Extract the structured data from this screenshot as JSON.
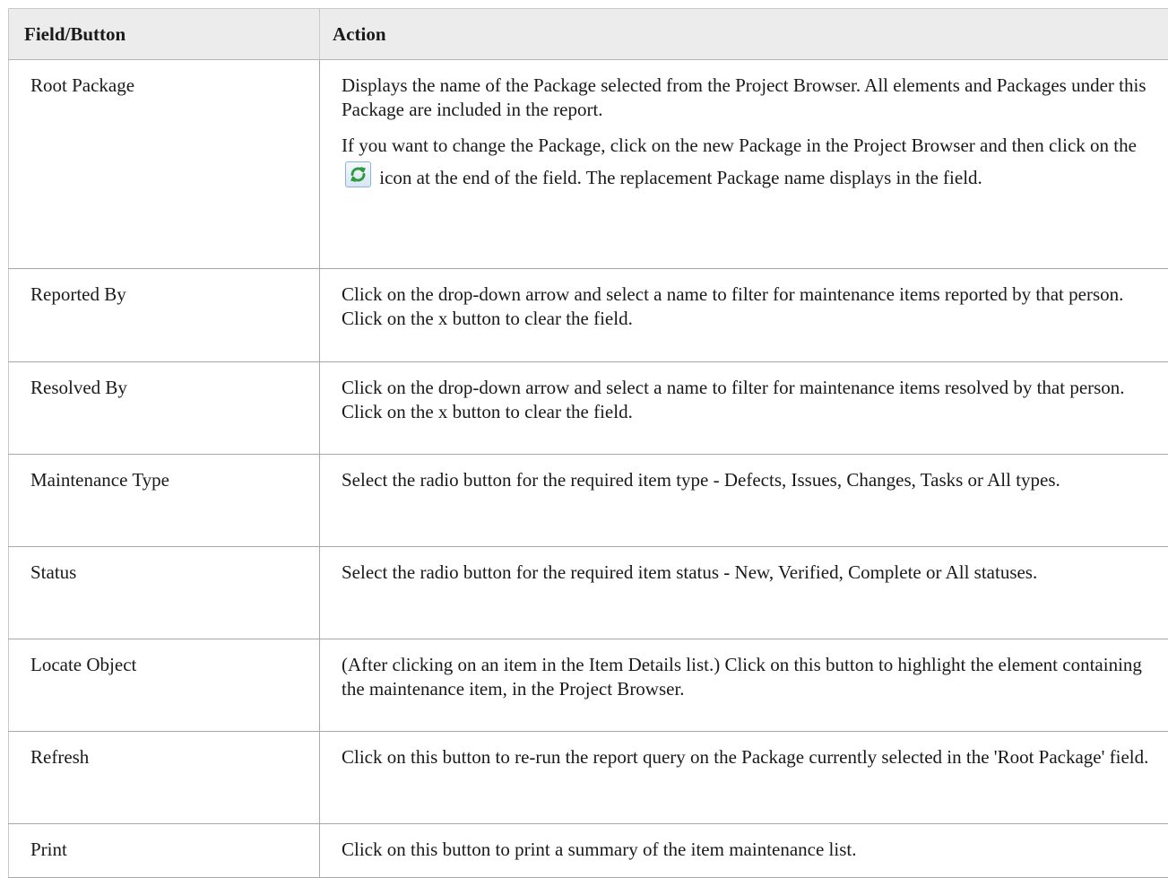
{
  "table": {
    "headers": {
      "field": "Field/Button",
      "action": "Action"
    },
    "rows": [
      {
        "field": "Root Package",
        "action_p1": "Displays the name of the Package selected from the Project Browser. All elements and Packages under this Package are included in the report.",
        "action_p2_before": "If you want to change the Package, click on the new Package in the Project Browser and then click on the",
        "action_p2_icon": "refresh-icon",
        "action_p2_after": "icon at the end of the field. The replacement Package name displays in the field."
      },
      {
        "field": "Reported By",
        "action": "Click on the drop-down arrow and select a name to filter for maintenance items reported by that person. Click on the x button to clear the field."
      },
      {
        "field": "Resolved By",
        "action": "Click on the drop-down arrow and select a name to filter for maintenance items resolved by that person. Click on the x button to clear the field."
      },
      {
        "field": "Maintenance Type",
        "action": "Select the radio button for the required item type - Defects, Issues, Changes, Tasks or All types."
      },
      {
        "field": "Status",
        "action": "Select the radio button for the required item status - New, Verified, Complete or All statuses."
      },
      {
        "field": "Locate Object",
        "action": "(After clicking on an item in the Item Details list.) Click on this button to highlight the element containing the maintenance item, in the Project Browser."
      },
      {
        "field": "Refresh",
        "action": "Click on this button to re-run the report query on the Package currently selected in the 'Root Package' field."
      },
      {
        "field": "Print",
        "action": "Click on this button to print a summary of the item maintenance list."
      }
    ]
  },
  "colors": {
    "header_bg": "#ececec",
    "border": "#a8a8a8",
    "icon_green": "#2e9a3a"
  }
}
